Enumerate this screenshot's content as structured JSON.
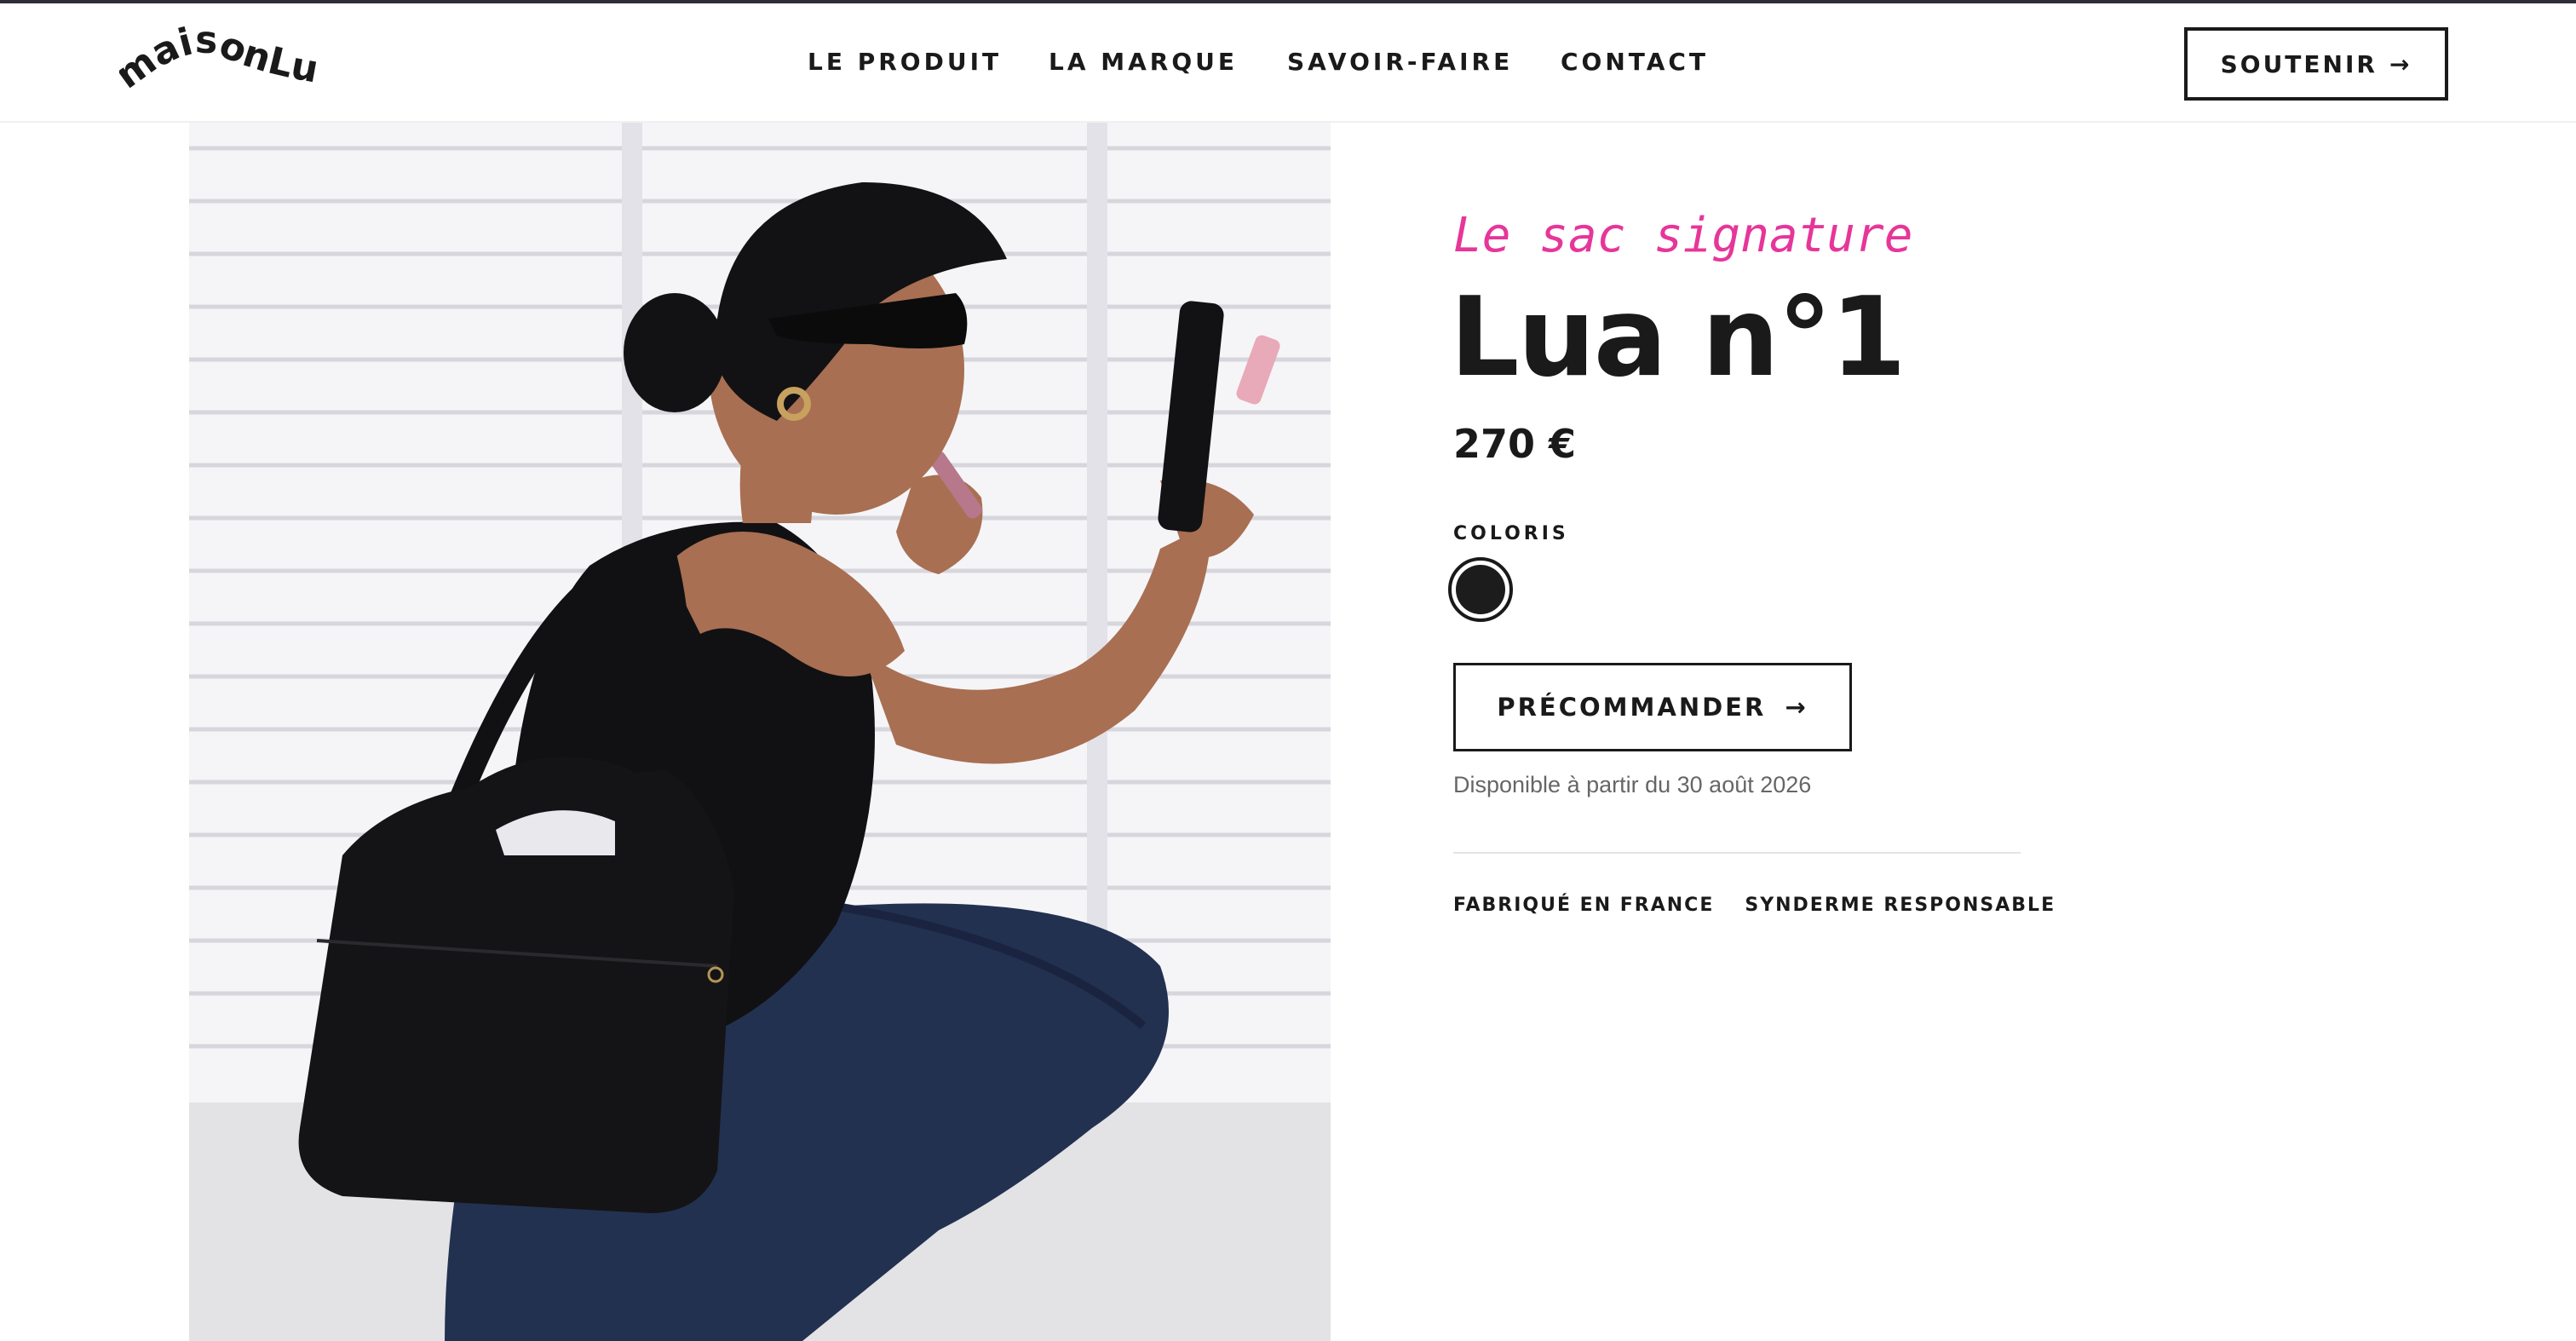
{
  "brand": {
    "logo_text": "maisonLua"
  },
  "nav": {
    "items": [
      {
        "label": "LE PRODUIT"
      },
      {
        "label": "LA MARQUE"
      },
      {
        "label": "SAVOIR-FAIRE"
      },
      {
        "label": "CONTACT"
      }
    ],
    "support_label": "SOUTENIR",
    "arrow_glyph": "→"
  },
  "product": {
    "tagline": "Le sac signature",
    "title": "Lua n°1",
    "price": "270 €",
    "color_label": "COLORIS",
    "colors": [
      {
        "hex": "#1c1c1c",
        "selected": true
      }
    ],
    "preorder_label": "PRÉCOMMANDER",
    "arrow_glyph": "→",
    "availability": "Disponible à partir du 30 août 2026",
    "badges": [
      "FABRIQUÉ EN FRANCE",
      "SYNDERME RESPONSABLE"
    ]
  },
  "theme": {
    "accent_pink": "#e6369a",
    "text_dark": "#1a1a1a",
    "muted_text": "#666666"
  }
}
